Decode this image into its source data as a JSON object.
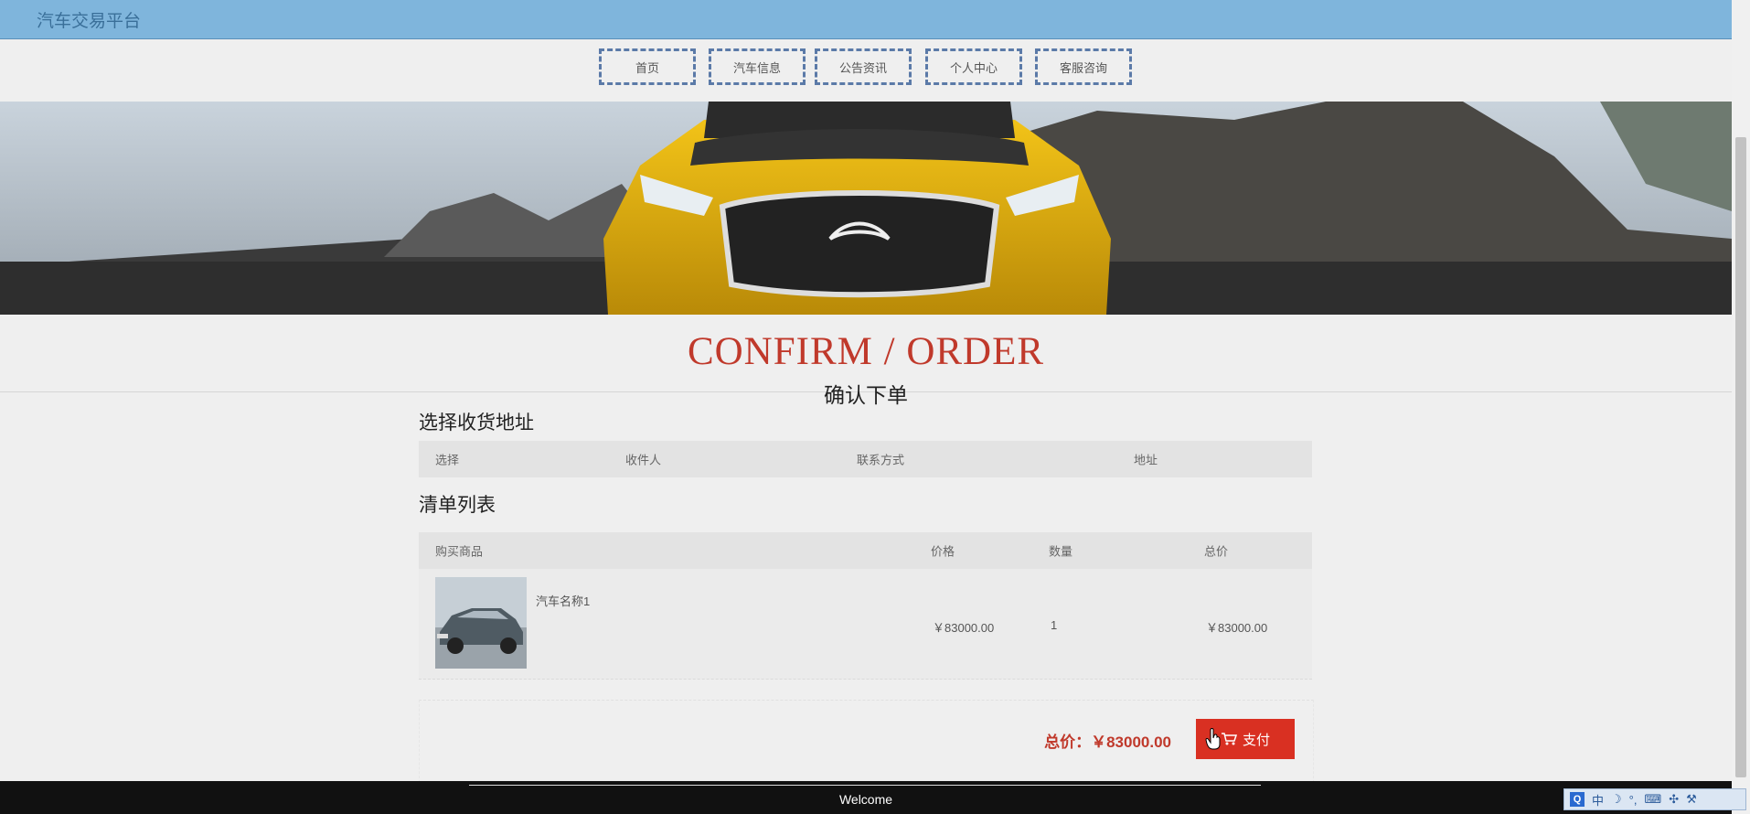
{
  "app": {
    "title": "汽车交易平台"
  },
  "nav": [
    {
      "label": "首页"
    },
    {
      "label": "汽车信息"
    },
    {
      "label": "公告资讯"
    },
    {
      "label": "个人中心"
    },
    {
      "label": "客服咨询"
    }
  ],
  "heading": {
    "en": "CONFIRM / ORDER",
    "cn": "确认下单"
  },
  "address": {
    "title": "选择收货地址",
    "columns": [
      "选择",
      "收件人",
      "联系方式",
      "地址"
    ]
  },
  "cart": {
    "title": "清单列表",
    "columns": [
      "购买商品",
      "价格",
      "数量",
      "总价"
    ],
    "items": [
      {
        "name": "汽车名称1",
        "price": "￥83000.00",
        "qty": "1",
        "total": "￥83000.00"
      }
    ]
  },
  "summary": {
    "total_label": "总价：￥83000.00",
    "pay_label": "支付"
  },
  "footer": {
    "text": "Welcome"
  },
  "ime": {
    "mode": "中"
  },
  "colors": {
    "accent": "#c0392b",
    "topbar": "#7fb5dc",
    "nav_border": "#5b7aa8"
  },
  "icons": [
    "cart-icon",
    "hand-cursor-icon"
  ]
}
